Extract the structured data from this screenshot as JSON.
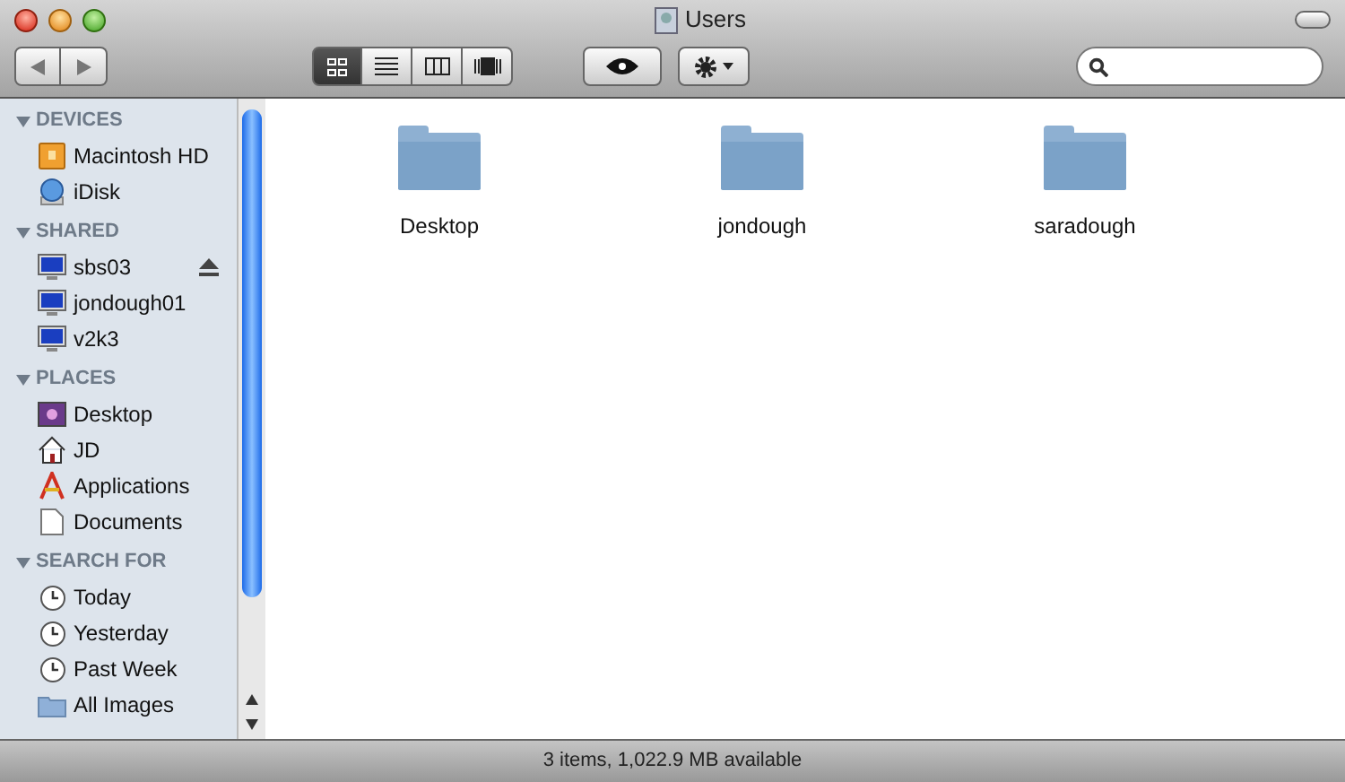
{
  "window": {
    "title": "Users"
  },
  "toolbar": {
    "view_buttons": [
      {
        "kind": "icons",
        "selected": true
      },
      {
        "kind": "list",
        "selected": false
      },
      {
        "kind": "columns",
        "selected": false
      },
      {
        "kind": "coverflow",
        "selected": false
      }
    ]
  },
  "sidebar": {
    "sections": [
      {
        "title": "DEVICES",
        "expanded": true,
        "items": [
          {
            "label": "Macintosh HD",
            "kind": "disk",
            "eject": false
          },
          {
            "label": "iDisk",
            "kind": "idisk",
            "eject": false
          }
        ]
      },
      {
        "title": "SHARED",
        "expanded": true,
        "items": [
          {
            "label": "sbs03",
            "kind": "monitor",
            "eject": true
          },
          {
            "label": "jondough01",
            "kind": "monitor",
            "eject": false
          },
          {
            "label": "v2k3",
            "kind": "monitor",
            "eject": false
          }
        ]
      },
      {
        "title": "PLACES",
        "expanded": true,
        "items": [
          {
            "label": "Desktop",
            "kind": "desktop",
            "eject": false
          },
          {
            "label": "JD",
            "kind": "home",
            "eject": false
          },
          {
            "label": "Applications",
            "kind": "apps",
            "eject": false
          },
          {
            "label": "Documents",
            "kind": "document",
            "eject": false
          }
        ]
      },
      {
        "title": "SEARCH FOR",
        "expanded": true,
        "items": [
          {
            "label": "Today",
            "kind": "clock",
            "eject": false
          },
          {
            "label": "Yesterday",
            "kind": "clock",
            "eject": false
          },
          {
            "label": "Past Week",
            "kind": "clock",
            "eject": false
          },
          {
            "label": "All Images",
            "kind": "folder",
            "eject": false
          }
        ]
      }
    ]
  },
  "files": [
    {
      "name": "Desktop"
    },
    {
      "name": "jondough"
    },
    {
      "name": "saradough"
    }
  ],
  "status_bar": "3 items, 1,022.9 MB available"
}
